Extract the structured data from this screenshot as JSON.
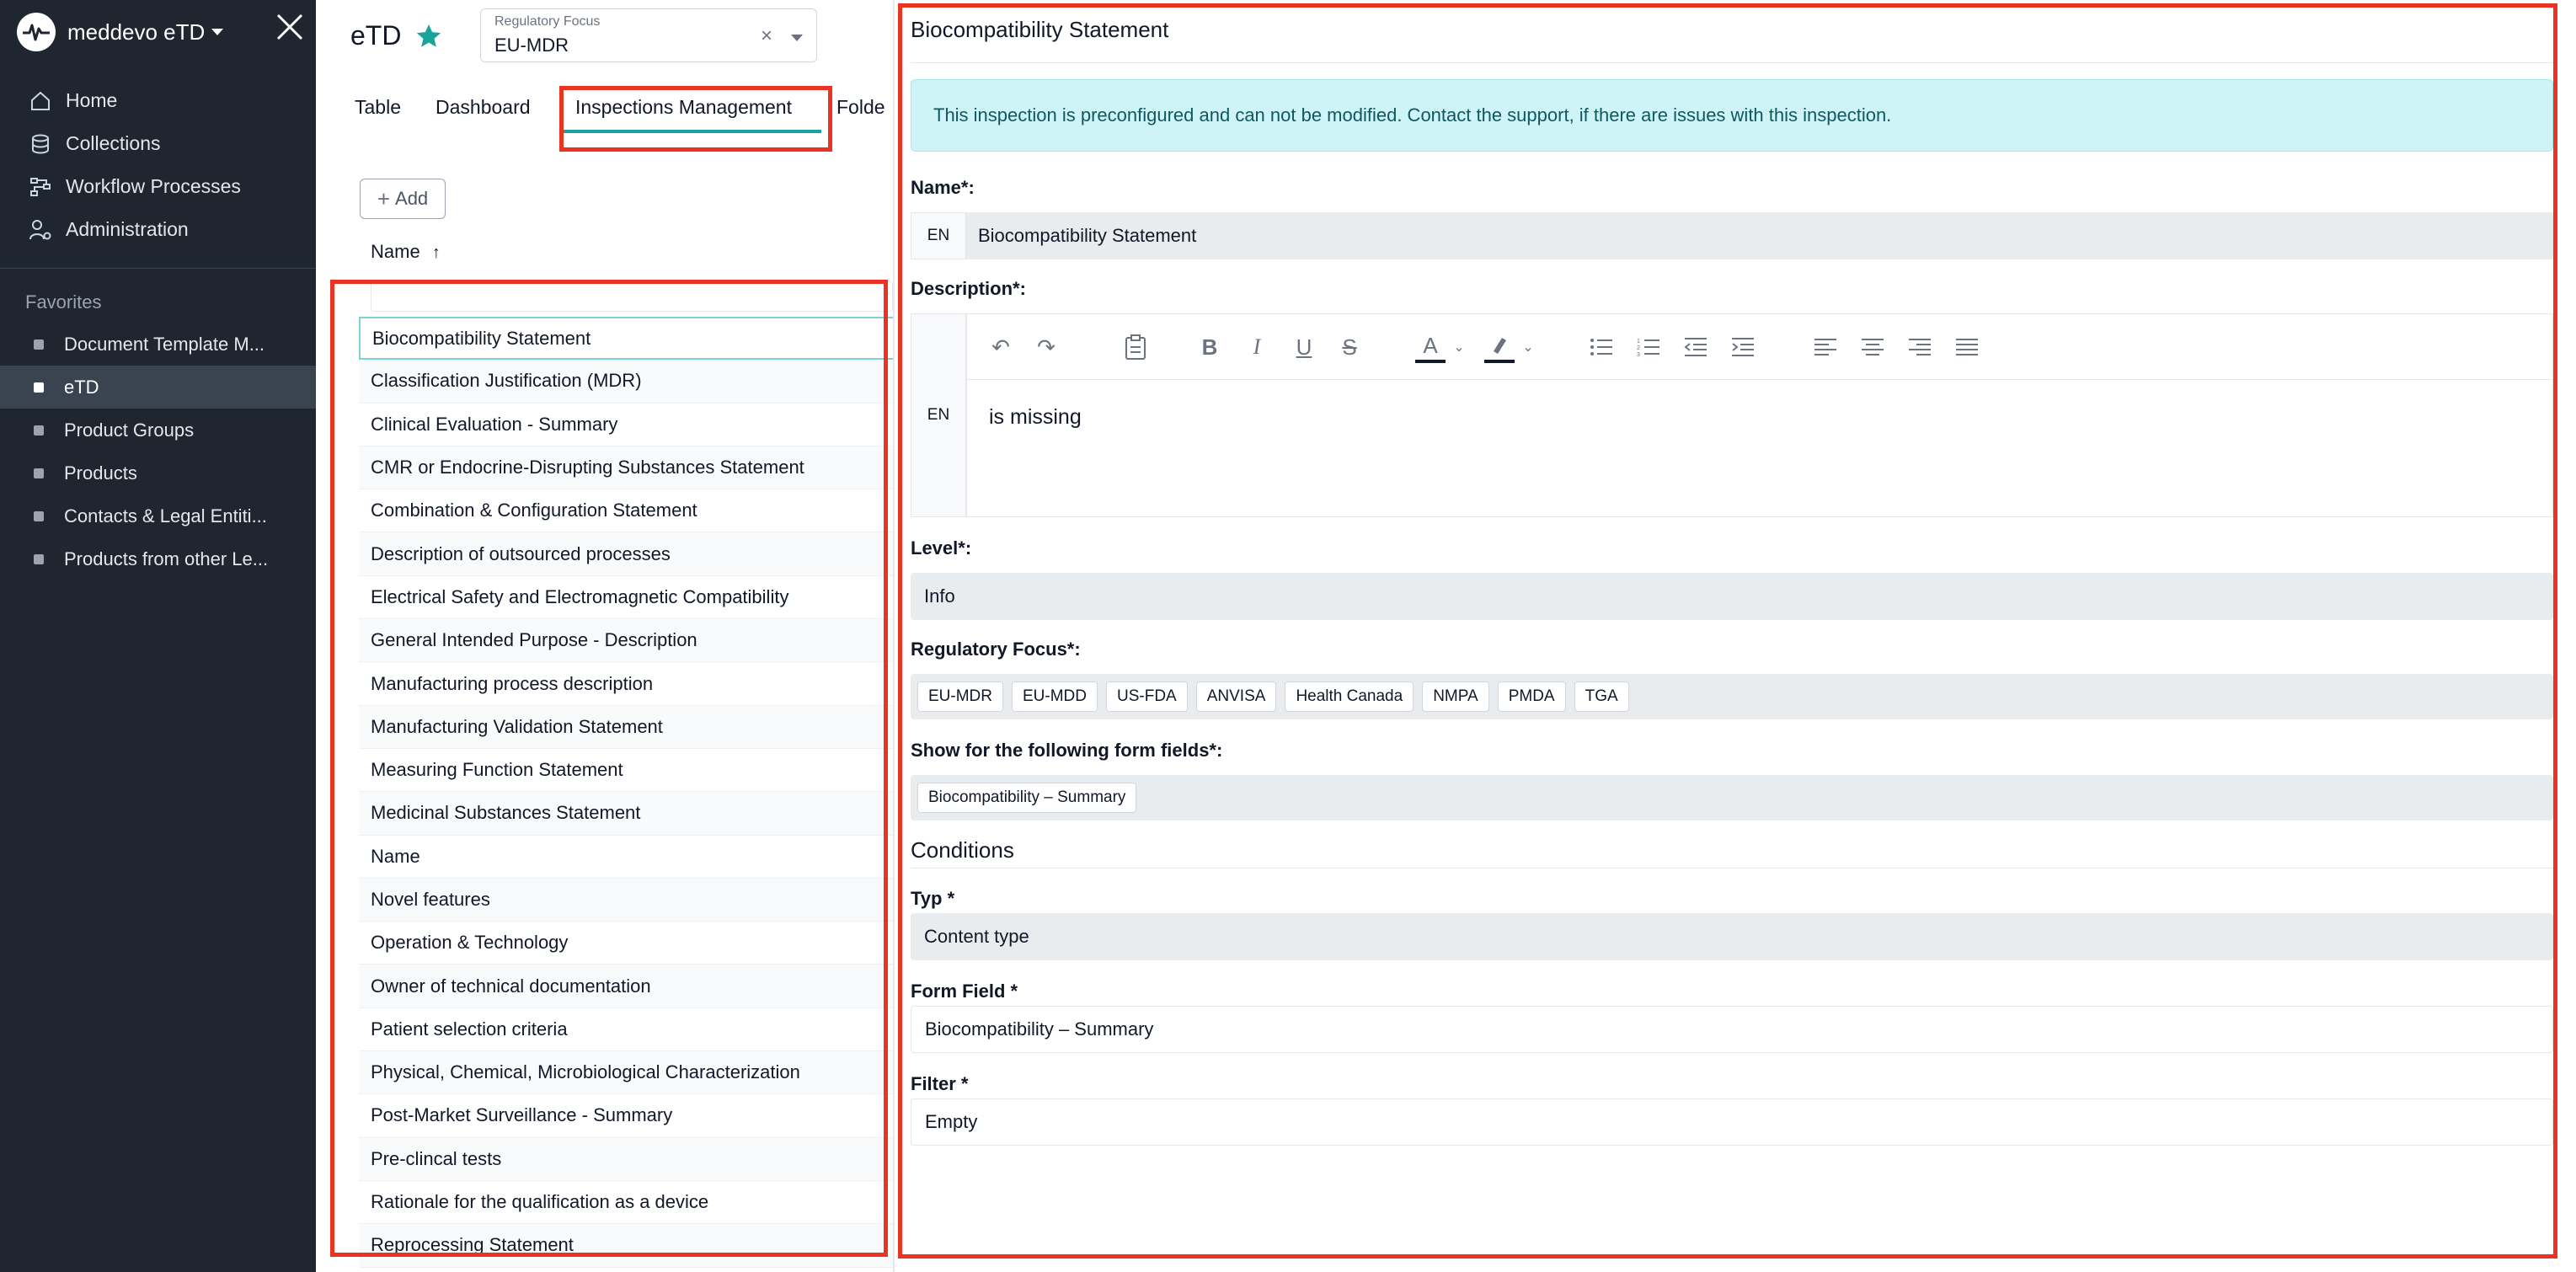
{
  "sidebar": {
    "brand": "meddevo eTD",
    "nav": [
      {
        "label": "Home",
        "icon": "home-icon"
      },
      {
        "label": "Collections",
        "icon": "database-icon"
      },
      {
        "label": "Workflow Processes",
        "icon": "workflow-icon"
      },
      {
        "label": "Administration",
        "icon": "user-gear-icon"
      }
    ],
    "favorites_title": "Favorites",
    "favorites": [
      {
        "label": "Document Template M..."
      },
      {
        "label": "eTD",
        "active": true
      },
      {
        "label": "Product Groups"
      },
      {
        "label": "Products"
      },
      {
        "label": "Contacts & Legal Entiti..."
      },
      {
        "label": "Products from other Le..."
      }
    ]
  },
  "header": {
    "title": "eTD",
    "regulatory_focus_label": "Regulatory Focus",
    "regulatory_focus_value": "EU-MDR",
    "clear_symbol": "×"
  },
  "tabs": [
    {
      "label": "Table"
    },
    {
      "label": "Dashboard"
    },
    {
      "label": "Inspections Management",
      "active": true
    },
    {
      "label": "Folde"
    }
  ],
  "list": {
    "add_label": "Add",
    "column_header": "Name",
    "sort_indicator": "↑",
    "items": [
      "Biocompatibility Statement",
      "Classification Justification (MDR)",
      "Clinical Evaluation - Summary",
      "CMR or Endocrine-Disrupting Substances Statement",
      "Combination & Configuration Statement",
      "Description of outsourced processes",
      "Electrical Safety and Electromagnetic Compatibility",
      "General Intended Purpose - Description",
      "Manufacturing process description",
      "Manufacturing Validation Statement",
      "Measuring Function Statement",
      "Medicinal Substances Statement",
      "Name",
      "Novel features",
      "Operation & Technology",
      "Owner of technical documentation",
      "Patient selection criteria",
      "Physical, Chemical, Microbiological Characterization",
      "Post-Market Surveillance - Summary",
      "Pre-clincal tests",
      "Rationale for the qualification as a device",
      "Reprocessing Statement"
    ]
  },
  "detail": {
    "title": "Biocompatibility Statement",
    "info": "This inspection is preconfigured and can not be modified. Contact the support, if there are issues with this inspection.",
    "name_label": "Name*:",
    "lang": "EN",
    "name_value": "Biocompatibility Statement",
    "description_label": "Description*:",
    "description_value": "is missing",
    "level_label": "Level*:",
    "level_value": "Info",
    "regfocus_label": "Regulatory Focus*:",
    "regfocus_chips": [
      "EU-MDR",
      "EU-MDD",
      "US-FDA",
      "ANVISA",
      "Health Canada",
      "NMPA",
      "PMDA",
      "TGA"
    ],
    "formfields_label": "Show for the following form fields*:",
    "formfields_chips": [
      "Biocompatibility – Summary"
    ],
    "conditions_title": "Conditions",
    "typ_label": "Typ *",
    "typ_value": "Content type",
    "formfield_label": "Form Field *",
    "formfield_value": "Biocompatibility – Summary",
    "filter_label": "Filter *",
    "filter_value": "Empty"
  }
}
